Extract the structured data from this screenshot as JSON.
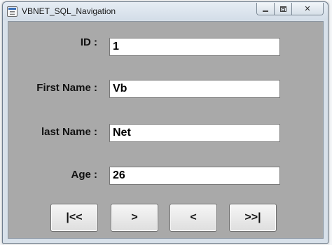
{
  "window": {
    "title": "VBNET_SQL_Navigation",
    "caption_buttons": [
      {
        "name": "minimize"
      },
      {
        "name": "maximize"
      },
      {
        "name": "close",
        "glyph": "✕"
      }
    ]
  },
  "form": {
    "fields": [
      {
        "label": "ID :",
        "value": "1"
      },
      {
        "label": "First Name :",
        "value": "Vb"
      },
      {
        "label": "last Name :",
        "value": "Net"
      },
      {
        "label": "Age :",
        "value": "26"
      }
    ],
    "buttons": [
      {
        "label": "|<<"
      },
      {
        "label": ">"
      },
      {
        "label": "<"
      },
      {
        "label": ">>|"
      }
    ]
  },
  "colors": {
    "client_background": "#a9a9a9",
    "window_frame": "#d8e1ea"
  }
}
